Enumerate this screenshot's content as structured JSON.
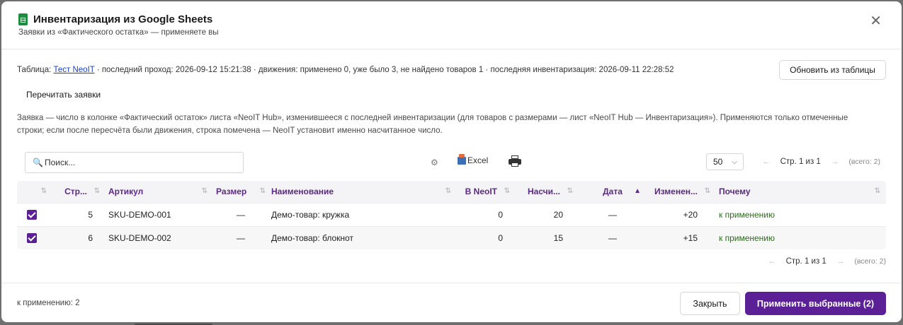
{
  "header": {
    "title": "Инвентаризация из Google Sheets",
    "subtitle": "Заявки из «Фактического остатка» — применяете вы"
  },
  "info": {
    "prefix": "Таблица: ",
    "link": "Тест NeoIT",
    "rest": " · последний проход: 2026-09-12 15:21:38 · движения: применено 0, уже было 3, не найдено товаров 1 · последняя инвентаризация: 2026-09-11 22:28:52"
  },
  "buttons": {
    "refresh": "Обновить из таблицы",
    "reread": "Перечитать заявки",
    "close": "Закрыть",
    "apply": "Применить выбранные (2)"
  },
  "description": "Заявка — число в колонке «Фактический остаток» листа «NeoIT Hub», изменившееся с последней инвентаризации (для товаров с размерами — лист «NeoIT Hub — Инвентаризация»). Применяются только отмеченные строки; если после пересчёта были движения, строка помечена — NeoIT установит именно насчитанное число.",
  "toolbar": {
    "search_placeholder": "Поиск...",
    "excel": "Excel",
    "page_size": "50"
  },
  "pager": {
    "prev": "←",
    "next": "→",
    "pages": "Стр. 1 из 1",
    "total": "(всего: 2)"
  },
  "table": {
    "columns": [
      "Стр...",
      "Артикул",
      "Размер",
      "Наименование",
      "В NeoIT",
      "Насчи...",
      "Дата",
      "Изменен...",
      "Почему"
    ],
    "rows": [
      {
        "row": "5",
        "sku": "SKU-DEMO-001",
        "size": "—",
        "name": "Демо-товар: кружка",
        "neoit": "0",
        "counted": "20",
        "date": "—",
        "change": "+20",
        "why": "к применению",
        "checked": true
      },
      {
        "row": "6",
        "sku": "SKU-DEMO-002",
        "size": "—",
        "name": "Демо-товар: блокнот",
        "neoit": "0",
        "counted": "15",
        "date": "—",
        "change": "+15",
        "why": "к применению",
        "checked": true
      }
    ]
  },
  "footer": {
    "status": "к применению: 2"
  },
  "colors": {
    "accent": "#5b1f96",
    "header_text": "#5b2a86",
    "status_green": "#2e6b1f"
  }
}
